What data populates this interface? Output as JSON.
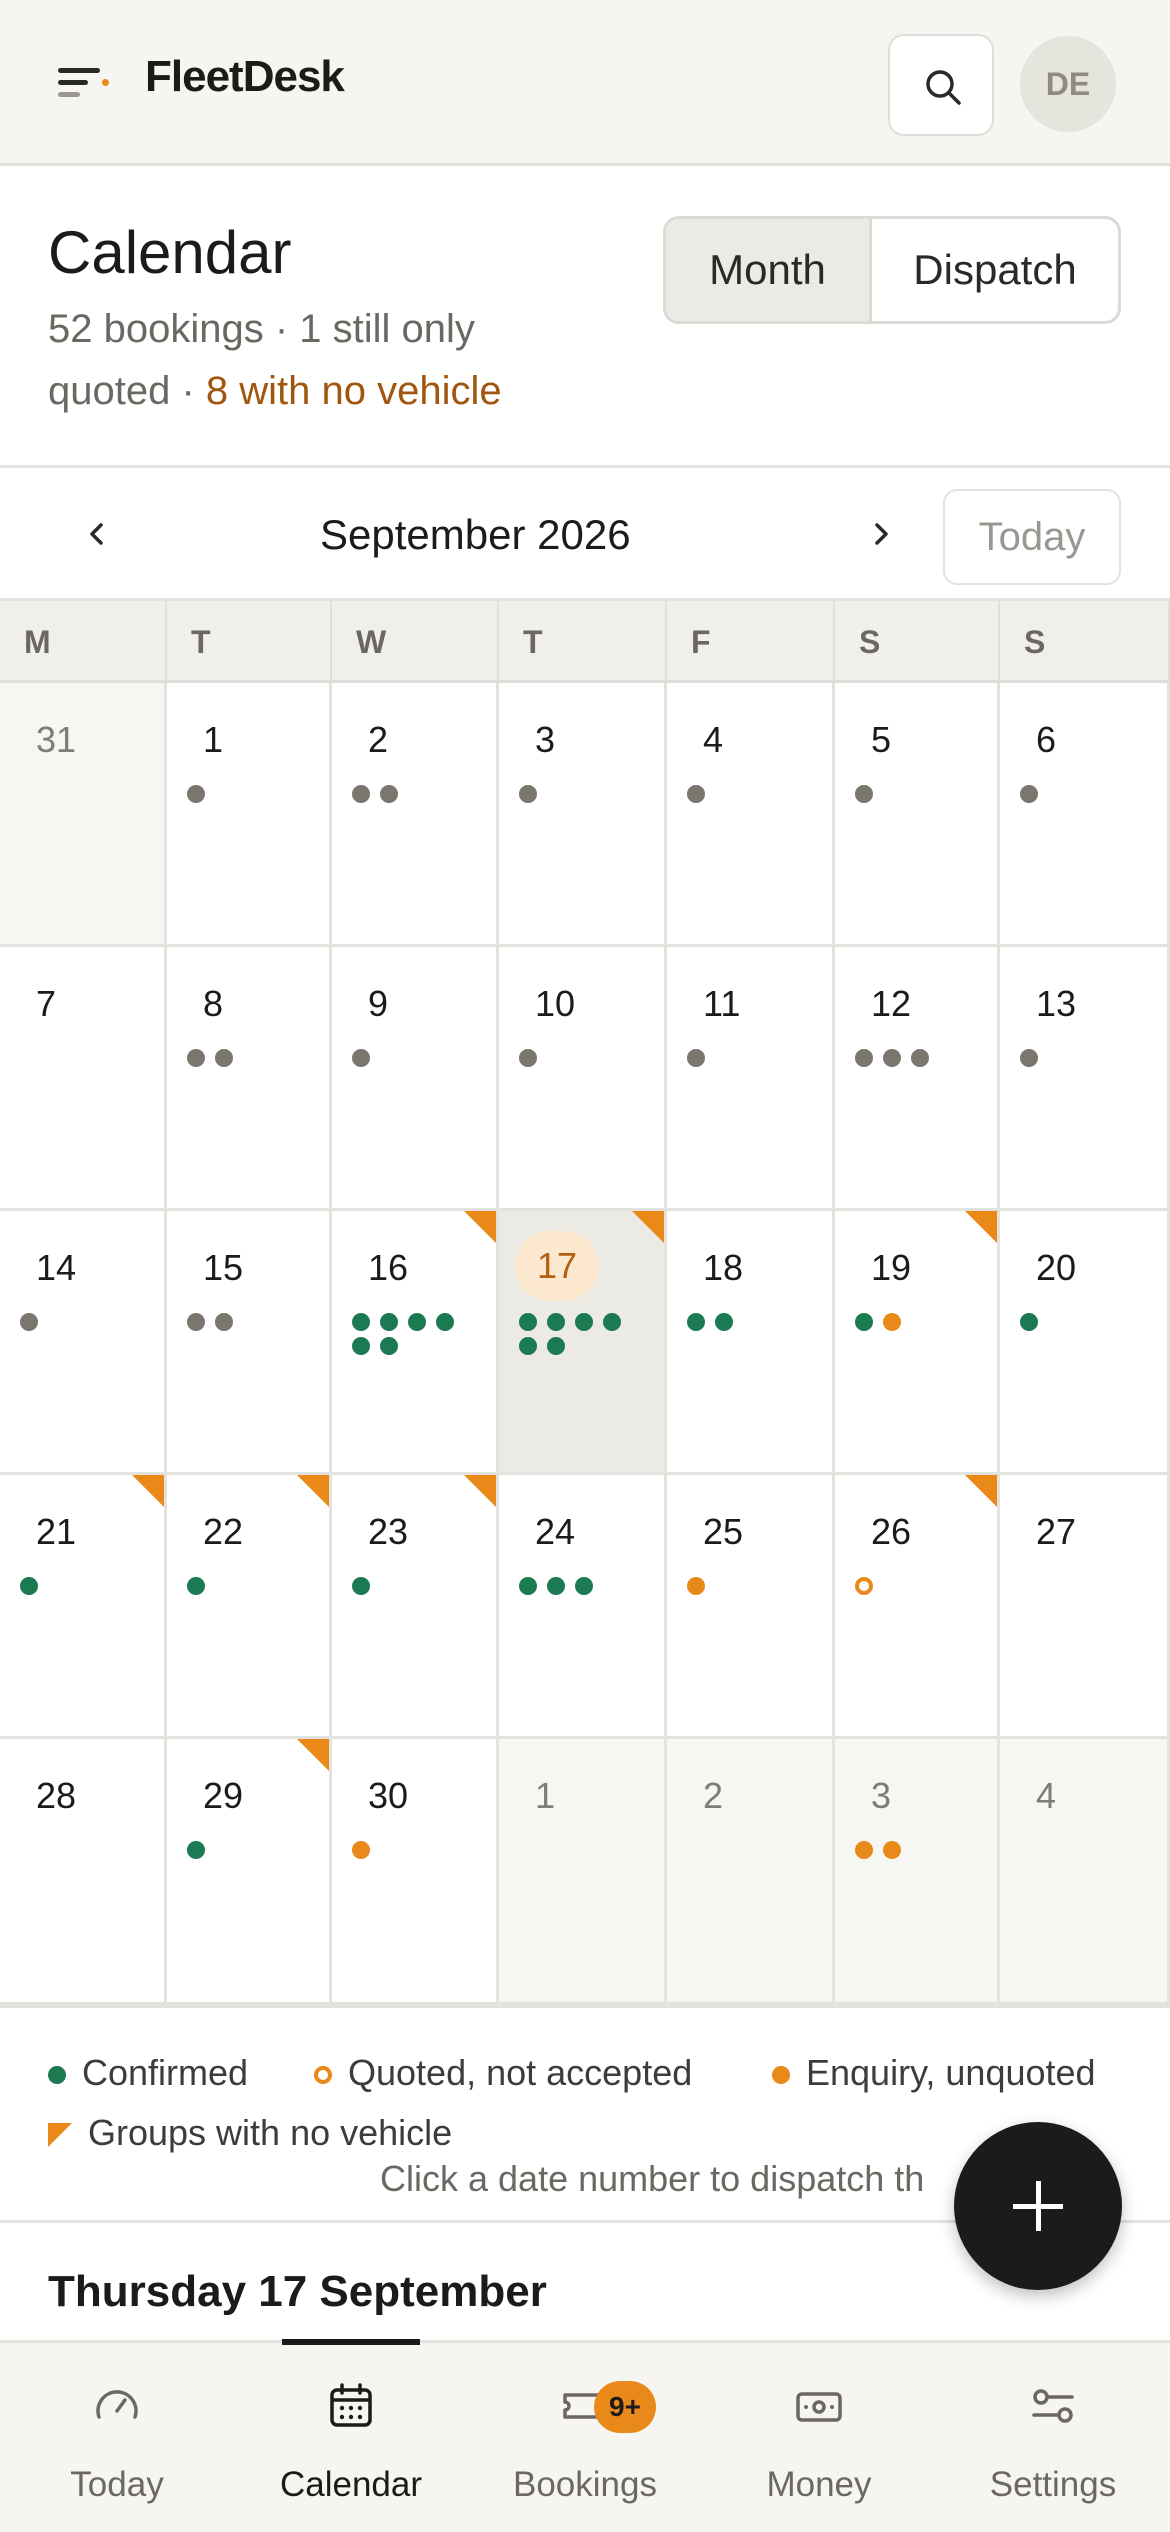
{
  "app": {
    "name": "FleetDesk",
    "user_initials": "DE"
  },
  "icons": {
    "menu": "menu-icon",
    "search": "search-icon",
    "prev": "chevron-left-icon",
    "next": "chevron-right-icon",
    "add": "plus-icon"
  },
  "colors": {
    "confirmed": "#1c7a53",
    "quoted": "#e8891a",
    "enquiry": "#e8891a",
    "no_vehicle_flag": "#e8891a",
    "booking": "#7a756d"
  },
  "page": {
    "title": "Calendar",
    "summary_prefix": "52 bookings · 1 still only quoted ·",
    "summary_warning": "8 with no vehicle"
  },
  "view_toggle": {
    "month": "Month",
    "dispatch": "Dispatch",
    "selected": "Month"
  },
  "month_nav": {
    "label": "September 2026",
    "today": "Today"
  },
  "weekdays": [
    "M",
    "T",
    "W",
    "T",
    "F",
    "S",
    "S"
  ],
  "weeks": [
    [
      {
        "day": "31",
        "muted": true,
        "dots": []
      },
      {
        "day": "1",
        "dots": [
          "grey"
        ]
      },
      {
        "day": "2",
        "dots": [
          "grey",
          "grey"
        ]
      },
      {
        "day": "3",
        "dots": [
          "grey"
        ]
      },
      {
        "day": "4",
        "dots": [
          "grey"
        ]
      },
      {
        "day": "5",
        "dots": [
          "grey"
        ]
      },
      {
        "day": "6",
        "dots": [
          "grey"
        ]
      }
    ],
    [
      {
        "day": "7",
        "dots": []
      },
      {
        "day": "8",
        "dots": [
          "grey",
          "grey"
        ]
      },
      {
        "day": "9",
        "dots": [
          "grey"
        ]
      },
      {
        "day": "10",
        "dots": [
          "grey"
        ]
      },
      {
        "day": "11",
        "dots": [
          "grey"
        ]
      },
      {
        "day": "12",
        "dots": [
          "grey",
          "grey",
          "grey"
        ]
      },
      {
        "day": "13",
        "dots": [
          "grey"
        ]
      }
    ],
    [
      {
        "day": "14",
        "dots": [
          "grey"
        ]
      },
      {
        "day": "15",
        "dots": [
          "grey",
          "grey"
        ]
      },
      {
        "day": "16",
        "flag": true,
        "dots": [
          "green",
          "green",
          "green",
          "green",
          "green",
          "green"
        ]
      },
      {
        "day": "17",
        "today": true,
        "flag": true,
        "dots": [
          "green",
          "green",
          "green",
          "green",
          "green",
          "green"
        ]
      },
      {
        "day": "18",
        "dots": [
          "green",
          "green"
        ]
      },
      {
        "day": "19",
        "flag": true,
        "dots": [
          "green",
          "orange"
        ]
      },
      {
        "day": "20",
        "dots": [
          "green"
        ]
      }
    ],
    [
      {
        "day": "21",
        "flag": true,
        "dots": [
          "green"
        ]
      },
      {
        "day": "22",
        "flag": true,
        "dots": [
          "green"
        ]
      },
      {
        "day": "23",
        "flag": true,
        "dots": [
          "green"
        ]
      },
      {
        "day": "24",
        "dots": [
          "green",
          "green",
          "green"
        ]
      },
      {
        "day": "25",
        "dots": [
          "orange"
        ]
      },
      {
        "day": "26",
        "flag": true,
        "dots": [
          "orange-ring"
        ]
      },
      {
        "day": "27",
        "dots": []
      }
    ],
    [
      {
        "day": "28",
        "dots": []
      },
      {
        "day": "29",
        "flag": true,
        "dots": [
          "green"
        ]
      },
      {
        "day": "30",
        "dots": [
          "orange"
        ]
      },
      {
        "day": "1",
        "muted": true,
        "dots": []
      },
      {
        "day": "2",
        "muted": true,
        "dots": []
      },
      {
        "day": "3",
        "muted": true,
        "dots": [
          "orange",
          "orange"
        ]
      },
      {
        "day": "4",
        "muted": true,
        "dots": []
      }
    ]
  ],
  "legend": {
    "confirmed": "Confirmed",
    "quoted": "Quoted, not accepted",
    "enquiry": "Enquiry, unquoted",
    "no_vehicle": "Groups with no vehicle",
    "hint": "Click a date number to dispatch th"
  },
  "day_panel": {
    "title": "Thursday 17 September"
  },
  "tabs": [
    {
      "label": "Today",
      "icon": "gauge-icon"
    },
    {
      "label": "Calendar",
      "icon": "calendar-icon",
      "active": true
    },
    {
      "label": "Bookings",
      "icon": "ticket-icon",
      "badge": "9+"
    },
    {
      "label": "Money",
      "icon": "banknote-icon"
    },
    {
      "label": "Settings",
      "icon": "sliders-icon"
    }
  ]
}
